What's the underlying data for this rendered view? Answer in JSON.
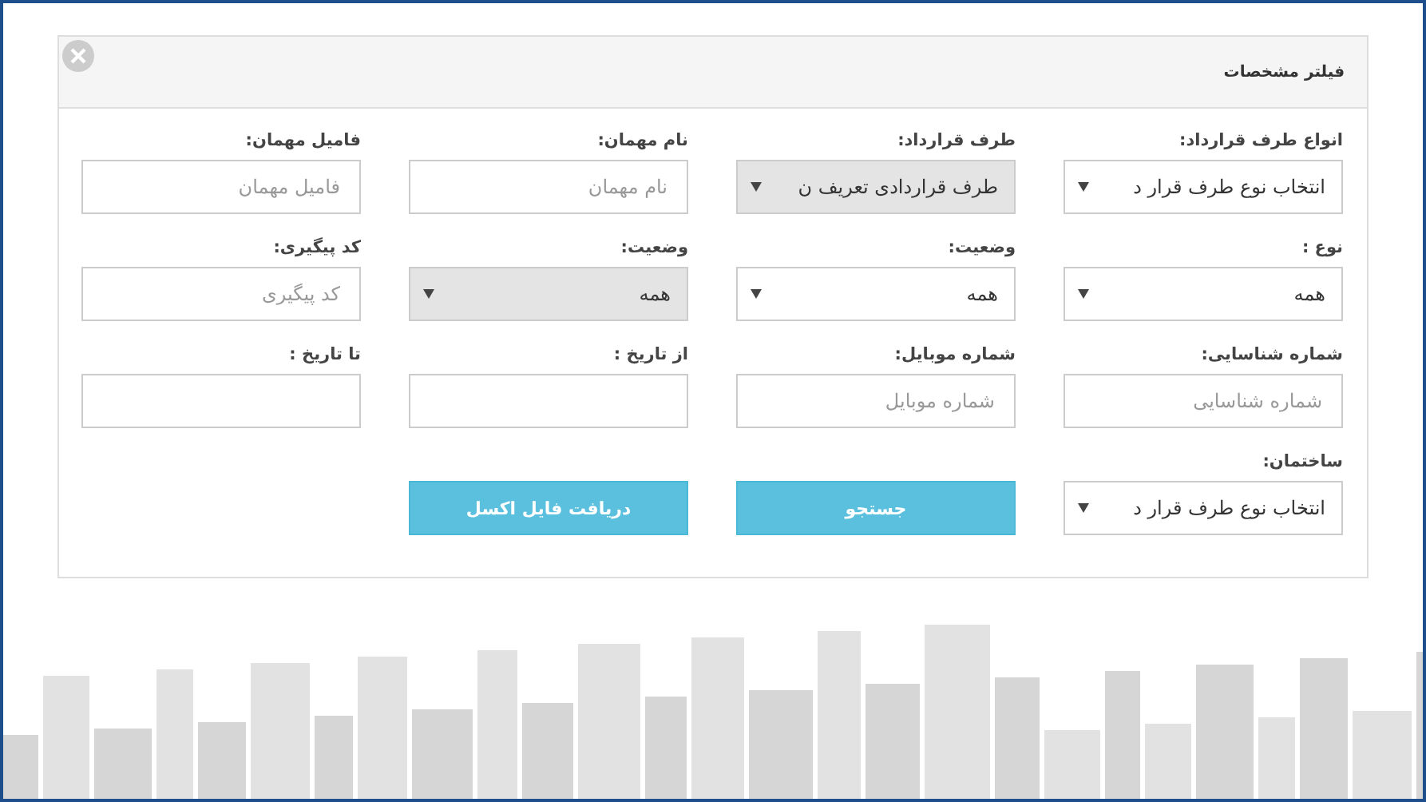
{
  "panel": {
    "title": "فیلتر مشخصات"
  },
  "fields": [
    {
      "kind": "select",
      "label": "انواع طرف قرارداد:",
      "value": "انتخاب نوع طرف قرار د",
      "disabled": false
    },
    {
      "kind": "select",
      "label": "طرف قرارداد:",
      "value": "طرف قراردادی تعریف ن",
      "disabled": true
    },
    {
      "kind": "text",
      "label": "نام مهمان:",
      "placeholder": "نام مهمان"
    },
    {
      "kind": "text",
      "label": "فامیل مهمان:",
      "placeholder": "فامیل مهمان"
    },
    {
      "kind": "select",
      "label": "نوع :",
      "value": "همه",
      "disabled": false
    },
    {
      "kind": "select",
      "label": "وضعیت:",
      "value": "همه",
      "disabled": false
    },
    {
      "kind": "select",
      "label": "وضعیت:",
      "value": "همه",
      "disabled": true
    },
    {
      "kind": "text",
      "label": "کد پیگیری:",
      "placeholder": "کد پیگیری"
    },
    {
      "kind": "text",
      "label": "شماره شناسایی:",
      "placeholder": "شماره شناسایی"
    },
    {
      "kind": "text",
      "label": "شماره موبایل:",
      "placeholder": "شماره موبایل"
    },
    {
      "kind": "text",
      "label": "از تاریخ :"
    },
    {
      "kind": "text",
      "label": "تا تاریخ :"
    },
    {
      "kind": "select",
      "label": "ساختمان:",
      "value": "انتخاب نوع طرف قرار د",
      "disabled": false
    },
    {
      "kind": "button",
      "text": "جستجو"
    },
    {
      "kind": "button",
      "text": "دریافت فایل اکسل"
    }
  ]
}
